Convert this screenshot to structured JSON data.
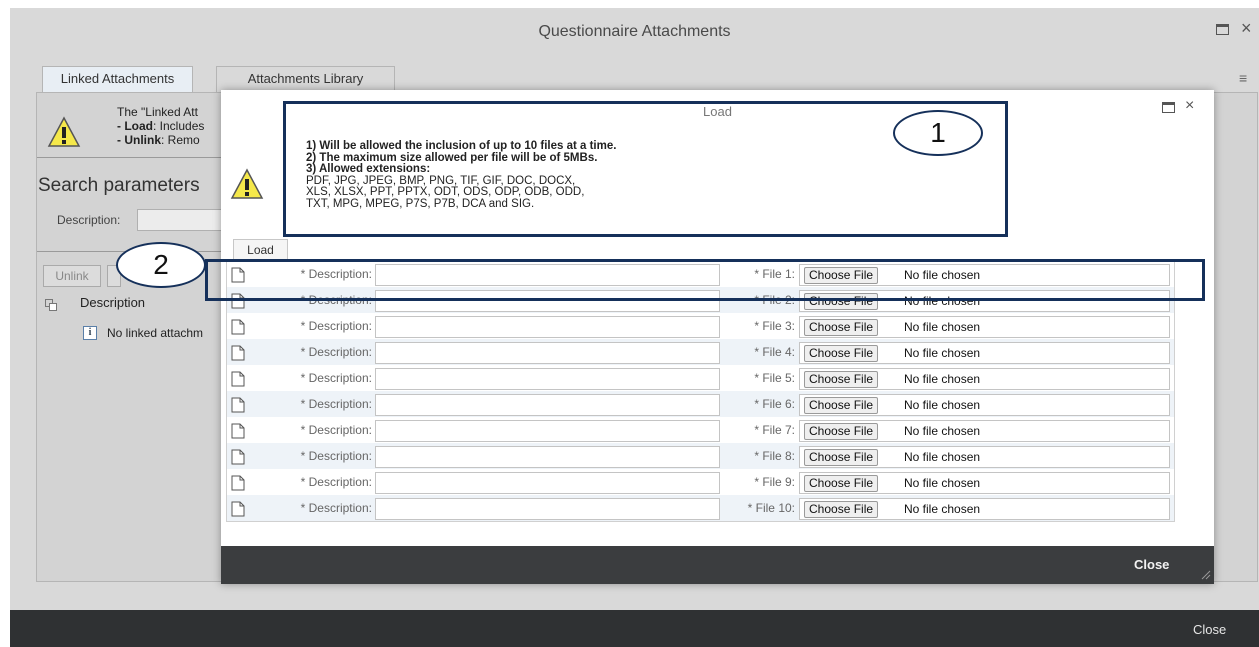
{
  "outer_dialog": {
    "title": "Questionnaire Attachments",
    "tabs": [
      {
        "label": "Linked Attachments"
      },
      {
        "label": "Attachments Library"
      }
    ],
    "info_lines": {
      "line1": "The \"Linked Att",
      "load_bold": "- Load",
      "load_rest": ": Includes",
      "unlink_bold": "- Unlink",
      "unlink_rest": ": Remo"
    },
    "search_heading": "Search parameters",
    "description_label": "Description:",
    "unlink_button": "Unlink",
    "column_description": "Description",
    "no_linked_text": "No linked attachm",
    "close_label": "Close"
  },
  "load_dialog": {
    "title": "Load",
    "rules": {
      "rule1": "1) Will be allowed the inclusion of up to 10 files at a time.",
      "rule2": "2) The maximum size allowed per file will be of 5MBs.",
      "rule3_heading": "3) Allowed extensions:",
      "extensions_line1": "PDF, JPG, JPEG, BMP, PNG, TIF, GIF, DOC, DOCX,",
      "extensions_line2": "XLS, XLSX, PPT, PPTX, ODT, ODS, ODP, ODB, ODD,",
      "extensions_line3": "TXT, MPG, MPEG, P7S, P7B, DCA and SIG."
    },
    "tab_label": "Load",
    "rows": [
      {
        "desc_label": "* Description:",
        "file_label": "* File 1:",
        "choose": "Choose File",
        "status": "No file chosen"
      },
      {
        "desc_label": "* Description:",
        "file_label": "* File 2:",
        "choose": "Choose File",
        "status": "No file chosen"
      },
      {
        "desc_label": "* Description:",
        "file_label": "* File 3:",
        "choose": "Choose File",
        "status": "No file chosen"
      },
      {
        "desc_label": "* Description:",
        "file_label": "* File 4:",
        "choose": "Choose File",
        "status": "No file chosen"
      },
      {
        "desc_label": "* Description:",
        "file_label": "* File 5:",
        "choose": "Choose File",
        "status": "No file chosen"
      },
      {
        "desc_label": "* Description:",
        "file_label": "* File 6:",
        "choose": "Choose File",
        "status": "No file chosen"
      },
      {
        "desc_label": "* Description:",
        "file_label": "* File 7:",
        "choose": "Choose File",
        "status": "No file chosen"
      },
      {
        "desc_label": "* Description:",
        "file_label": "* File 8:",
        "choose": "Choose File",
        "status": "No file chosen"
      },
      {
        "desc_label": "* Description:",
        "file_label": "* File 9:",
        "choose": "Choose File",
        "status": "No file chosen"
      },
      {
        "desc_label": "* Description:",
        "file_label": "* File 10:",
        "choose": "Choose File",
        "status": "No file chosen"
      }
    ],
    "close_label": "Close"
  },
  "annotations": {
    "marker1": "1",
    "marker2": "2"
  },
  "colors": {
    "annotation": "#15305a",
    "footer": "#2f3133",
    "warning_fill": "#f5e84a",
    "row_alt": "#eef3f8"
  },
  "icons": [
    "warning-icon",
    "maximize-icon",
    "close-icon",
    "menu-icon",
    "document-icon",
    "info-icon",
    "resize-grip-icon"
  ]
}
